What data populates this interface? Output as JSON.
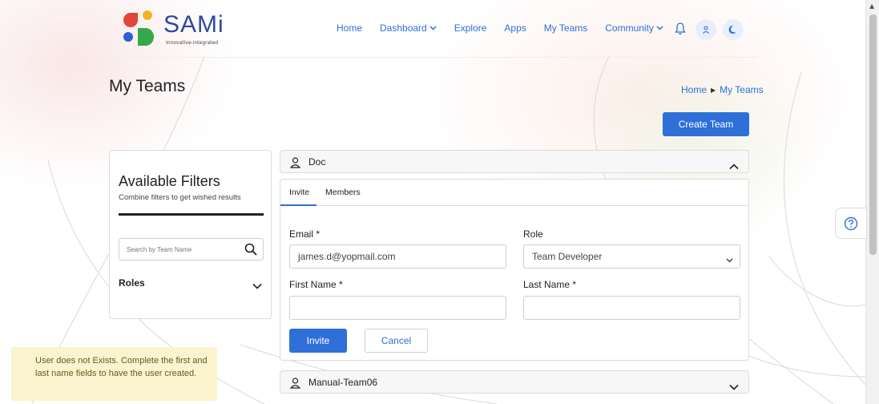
{
  "brand": {
    "name": "SAMi",
    "tagline": "Innovative-integrated"
  },
  "nav": {
    "items": [
      {
        "label": "Home"
      },
      {
        "label": "Dashboard"
      },
      {
        "label": "Explore"
      },
      {
        "label": "Apps"
      },
      {
        "label": "My Teams"
      },
      {
        "label": "Community"
      }
    ]
  },
  "page": {
    "title": "My Teams",
    "breadcrumb": [
      "Home",
      "My Teams"
    ],
    "create_team_label": "Create Team"
  },
  "filters": {
    "title": "Available Filters",
    "subtitle": "Combine filters to get wished results",
    "search_placeholder": "Search by Team Name",
    "roles_label": "Roles"
  },
  "teams": [
    {
      "name": "Doc",
      "expanded": true
    },
    {
      "name": "Manual-Team06",
      "expanded": false
    }
  ],
  "invite_form": {
    "tabs": [
      "Invite",
      "Members"
    ],
    "email_label": "Email *",
    "email_value": "james.d@yopmail.com",
    "role_label": "Role",
    "role_value": "Team Developer",
    "first_name_label": "First Name *",
    "first_name_value": "",
    "last_name_label": "Last Name *",
    "last_name_value": "",
    "invite_label": "Invite",
    "cancel_label": "Cancel"
  },
  "toast": {
    "message": "User does not Exists. Complete the first and last name fields to have the user created."
  },
  "colors": {
    "accent": "#2f6fd8",
    "toast_bg": "#fcf3cf",
    "toast_text": "#6b5a1f"
  }
}
